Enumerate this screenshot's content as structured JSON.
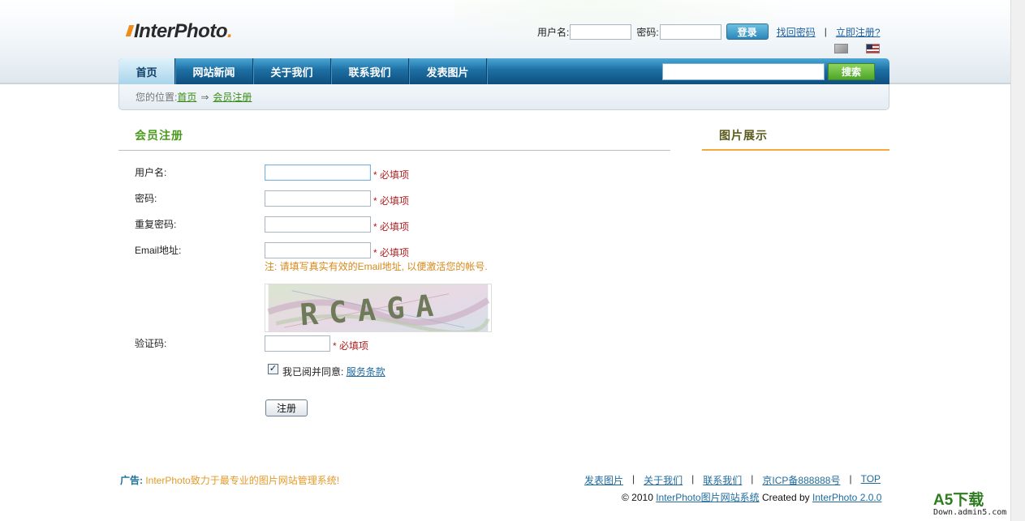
{
  "site": {
    "logo": "InterPhoto",
    "logo_dot": "."
  },
  "login": {
    "username_label": "用户名:",
    "password_label": "密码:",
    "login_button": "登录",
    "forgot_link": "找回密码",
    "separator": "|",
    "register_link": "立即注册?"
  },
  "nav": {
    "items": [
      "首页",
      "网站新闻",
      "关于我们",
      "联系我们",
      "发表图片"
    ],
    "search_button": "搜索"
  },
  "breadcrumb": {
    "prefix": "您的位置:",
    "home": "首页",
    "arrow": "⇒",
    "current": "会员注册"
  },
  "main": {
    "title": "会员注册",
    "fields": {
      "username": {
        "label": "用户名:",
        "required": "* 必填项"
      },
      "password": {
        "label": "密码:",
        "required": "* 必填项"
      },
      "confirm": {
        "label": "重复密码:",
        "required": "* 必填项"
      },
      "email": {
        "label": "Email地址:",
        "required": "* 必填项"
      },
      "captcha": {
        "label": "验证码:",
        "required": "* 必填项"
      }
    },
    "email_note": "注: 请填写真实有效的Email地址, 以便激活您的帐号.",
    "captcha_text": "RCAGA",
    "agree_text": "我已阅并同意:",
    "terms_link": "服务条款",
    "checkbox_mark": "✓",
    "submit_button": "注册"
  },
  "sidebar": {
    "title": "图片展示"
  },
  "footer": {
    "ad_label": "广告:",
    "ad_text": "InterPhoto致力于最专业的图片网站管理系统!",
    "links": [
      "发表图片",
      "关于我们",
      "联系我们",
      "京ICP备888888号",
      "TOP"
    ],
    "link_sep": "|",
    "copyright_prefix": "© 2010",
    "system_link": "InterPhoto图片网站系统",
    "created_by": "Created by",
    "version_link": "InterPhoto 2.0.0"
  },
  "watermark": {
    "title": "A5下载",
    "domain": "Down.admin5.com"
  },
  "colors": {
    "accent_green": "#4a9a1c",
    "nav_blue": "#1d6fa3",
    "required_red": "#b02020",
    "note_orange": "#d5891a"
  }
}
